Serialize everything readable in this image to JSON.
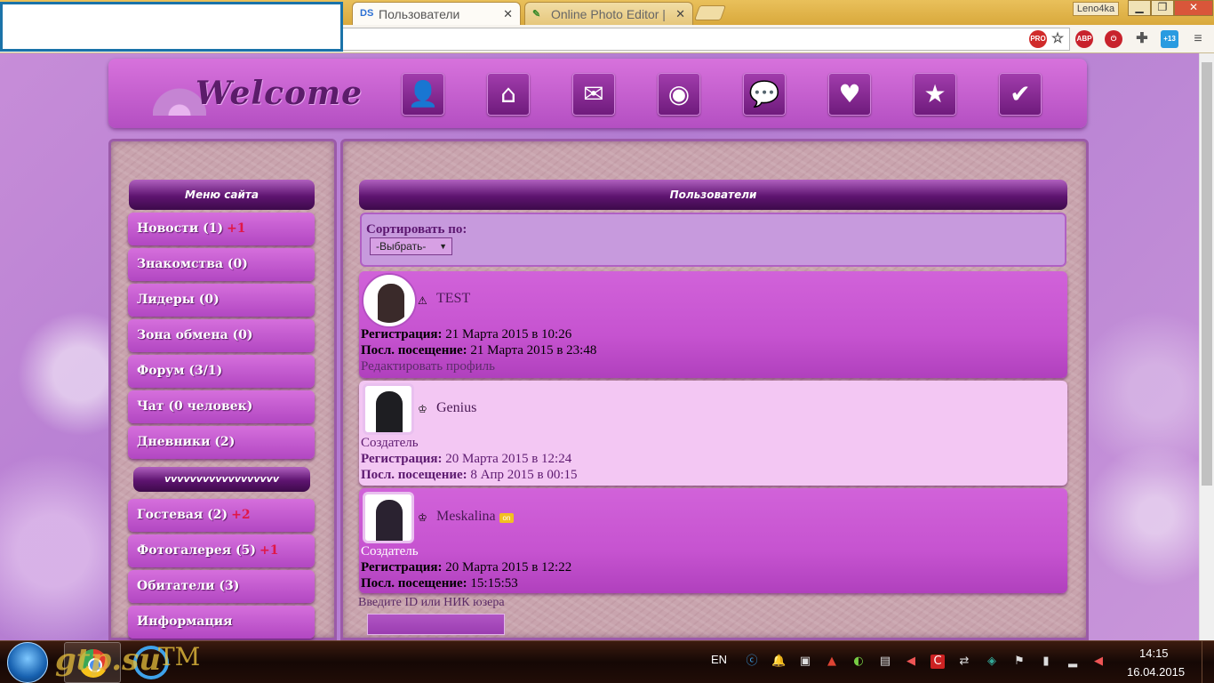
{
  "browser": {
    "tabs": [
      {
        "label": "Пользователи",
        "favicon": "DS",
        "active": true
      },
      {
        "label": "Online Photo Editor |",
        "favicon": "pencil",
        "active": false
      }
    ],
    "user_badge": "Leno4ka",
    "window_controls": {
      "minimize": "▁",
      "maximize": "❐",
      "close": "✕"
    },
    "extensions": [
      "PRO",
      "ABP",
      "+13"
    ]
  },
  "header": {
    "logo_text": "Welcome",
    "nav_icons": [
      "user-icon",
      "home-icon",
      "mail-icon",
      "rss-icon",
      "chat-icon",
      "heart-icon",
      "star-icon",
      "checkmark-icon"
    ]
  },
  "sidebar": {
    "title": "Меню сайта",
    "items": [
      {
        "label": "Новости (1)",
        "plus": "+1"
      },
      {
        "label": "Знакомства (0)",
        "plus": ""
      },
      {
        "label": "Лидеры (0)",
        "plus": ""
      },
      {
        "label": "Зона обмена (0)",
        "plus": ""
      },
      {
        "label": "Форум (3/1)",
        "plus": ""
      },
      {
        "label": "Чат (0 человек)",
        "plus": ""
      },
      {
        "label": "Дневники (2)",
        "plus": ""
      }
    ],
    "section2_title": "vvvvvvvvvvvvvvvvvv",
    "items2": [
      {
        "label": "Гостевая (2)",
        "plus": "+2"
      },
      {
        "label": "Фотогалерея (5)",
        "plus": "+1"
      },
      {
        "label": "Обитатели (3)",
        "plus": ""
      },
      {
        "label": "Информация",
        "plus": ""
      }
    ]
  },
  "main": {
    "title": "Пользователи",
    "sort_label": "Сортировать по:",
    "sort_value": "-Выбрать-",
    "reg_label": "Регистрация:",
    "visit_label": "Посл. посещение:",
    "users": [
      {
        "name": "TEST",
        "role": "",
        "registered": "21 Марта 2015 в 10:26",
        "last_visit": "21 Марта 2015 в 23:48",
        "extra": "Редактировать профиль",
        "online": false
      },
      {
        "name": "Genius",
        "role": "Создатель",
        "registered": "20 Марта 2015 в 12:24",
        "last_visit": "8 Апр 2015 в 00:15",
        "extra": "",
        "online": false
      },
      {
        "name": "Meskalina",
        "role": "Создатель",
        "registered": "20 Марта 2015 в 12:22",
        "last_visit": "15:15:53",
        "extra": "",
        "online": true
      }
    ],
    "online_badge": "on",
    "search_label": "Введите ID или НИК юзера"
  },
  "taskbar": {
    "watermark": "gtp.su",
    "watermark2": "TM",
    "lang": "EN",
    "time": "14:15",
    "date": "16.04.2015"
  },
  "colors": {
    "accent": "#b44fc2",
    "dark_header": "#5e1470",
    "plus_red": "#e01747"
  }
}
